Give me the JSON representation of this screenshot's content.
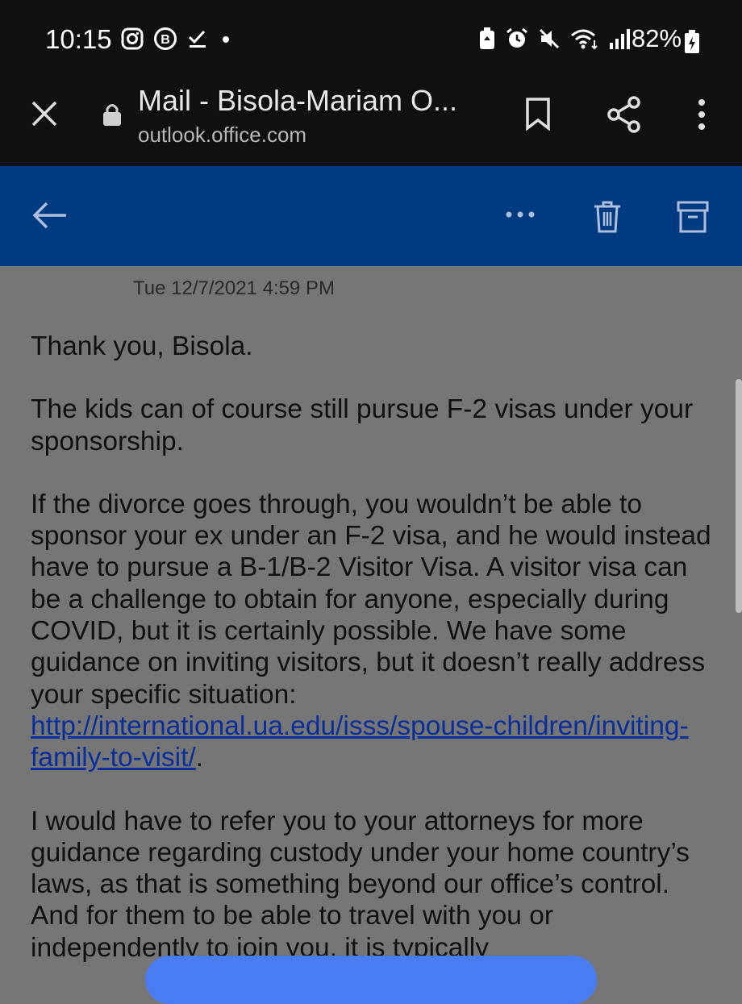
{
  "status_bar": {
    "time": "10:15",
    "battery": "82%"
  },
  "browser": {
    "title": "Mail - Bisola-Mariam O...",
    "url": "outlook.office.com"
  },
  "email": {
    "date": "Tue 12/7/2021 4:59 PM",
    "greeting": "Thank you, Bisola.",
    "para1": "The kids can of course still pursue F-2 visas under your sponsorship.",
    "para2": "If the divorce goes through, you wouldn’t be able to sponsor your ex under an F-2 visa, and he would instead have to pursue a B-1/B-2 Visitor Visa.  A visitor visa can be a challenge to obtain for anyone, especially during COVID, but it is certainly possible. We have some guidance on inviting visitors, but it doesn’t really address your specific situation: ",
    "link": "http://international.ua.edu/isss/spouse-children/inviting-family-to-visit/",
    "para2_end": ".",
    "para3": "I would have to refer you to your attorneys for more guidance regarding custody under your home country’s laws, as that is something beyond our office’s control.  And for them to be able to travel with you or independently to join you, it is typically"
  },
  "colors": {
    "toolbar": "#003a80",
    "link": "#0a2f9c",
    "background": "#767676"
  }
}
